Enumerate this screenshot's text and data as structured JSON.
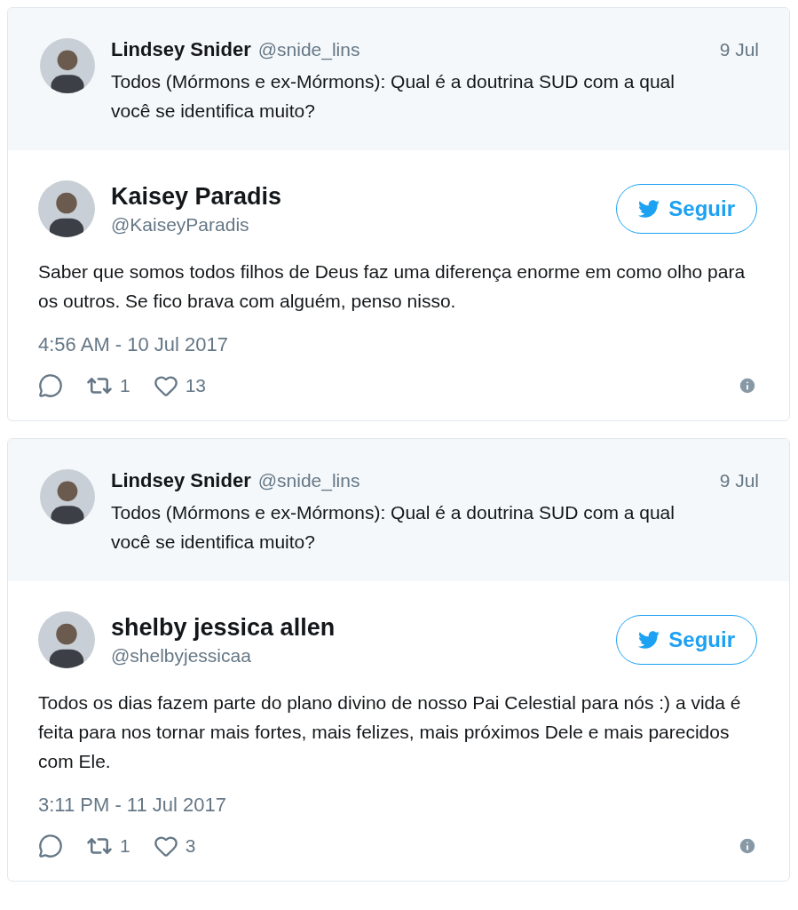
{
  "threads": [
    {
      "quoted": {
        "name": "Lindsey Snider",
        "handle": "@snide_lins",
        "date": "9 Jul",
        "text": "Todos (Mórmons e ex-Mórmons): Qual é a doutrina SUD com a qual você se identifica muito?"
      },
      "reply": {
        "name": "Kaisey Paradis",
        "handle": "@KaiseyParadis",
        "follow_label": "Seguir",
        "text": "Saber que somos todos filhos de Deus faz uma diferença enorme em como olho para os outros. Se fico brava com alguém, penso nisso.",
        "timestamp": "4:56 AM - 10 Jul 2017",
        "retweets": "1",
        "likes": "13"
      }
    },
    {
      "quoted": {
        "name": "Lindsey Snider",
        "handle": "@snide_lins",
        "date": "9 Jul",
        "text": "Todos (Mórmons e ex-Mórmons): Qual é a doutrina SUD com a qual você se identifica muito?"
      },
      "reply": {
        "name": "shelby jessica allen",
        "handle": "@shelbyjessicaa",
        "follow_label": "Seguir",
        "text": "Todos os dias fazem parte do plano divino de nosso Pai Celestial para nós :) a vida é feita para nos tornar mais fortes, mais felizes, mais próximos Dele e mais parecidos com Ele.",
        "timestamp": "3:11 PM - 11 Jul 2017",
        "retweets": "1",
        "likes": "3"
      }
    }
  ]
}
